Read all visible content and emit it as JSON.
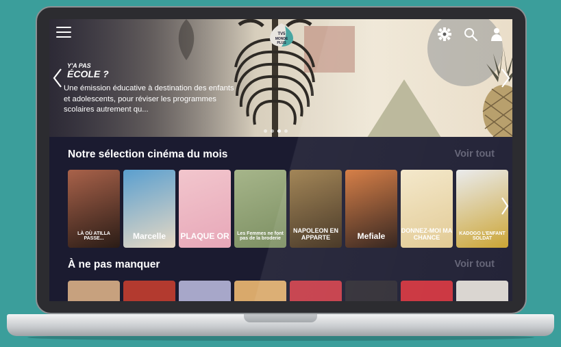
{
  "app": {
    "logo_text": "TV5 MONDE PLUS"
  },
  "hero": {
    "show_logo_line1": "Y'A PAS",
    "show_logo_line2": "ÉCOLE ?",
    "description": "Une émission éducative à destination des enfants et adolescents, pour réviser les programmes scolaires autrement qu...",
    "slide_count": 4,
    "active_slide": 2
  },
  "sections": [
    {
      "title": "Notre sélection cinéma du mois",
      "see_all": "Voir tout",
      "posters": [
        {
          "caption": "LÀ OÙ ATILLA PASSE...",
          "colors": [
            "#a9624a",
            "#2a1c16"
          ]
        },
        {
          "caption": "Marcelle",
          "colors": [
            "#5a9fcf",
            "#e7d9c4"
          ]
        },
        {
          "caption": "PLAQUE OR",
          "colors": [
            "#f2c6cd",
            "#e7a7b8"
          ]
        },
        {
          "caption": "Les Femmes ne font pas de la broderie",
          "colors": [
            "#a6b58a",
            "#7c8f62"
          ]
        },
        {
          "caption": "NAPOLEON EN APPARTE",
          "colors": [
            "#9c7d4b",
            "#3e2d1b"
          ]
        },
        {
          "caption": "Mefiale",
          "colors": [
            "#d4773c",
            "#2b1a14"
          ]
        },
        {
          "caption": "DONNEZ-MOI MA CHANCE",
          "colors": [
            "#f3e7c9",
            "#e1c88f"
          ]
        },
        {
          "caption": "KADOGO L'ENFANT SOLDAT",
          "colors": [
            "#e9eaec",
            "#c9a12c"
          ]
        }
      ]
    },
    {
      "title": "À ne pas manquer",
      "see_all": "Voir tout",
      "posters": [
        {
          "colors": [
            "#c7a17e"
          ]
        },
        {
          "colors": [
            "#b33a2f"
          ]
        },
        {
          "colors": [
            "#a7a7c9"
          ]
        },
        {
          "colors": [
            "#d9a96b"
          ]
        },
        {
          "colors": [
            "#c43a46"
          ]
        },
        {
          "colors": [
            "#2e2b33"
          ]
        },
        {
          "colors": [
            "#c92f3a"
          ]
        },
        {
          "colors": [
            "#d8d4cf"
          ]
        }
      ]
    }
  ],
  "colors": {
    "background": "#3b9e9b",
    "app_background": "#1b1b30",
    "see_all": "#5f5f72"
  }
}
